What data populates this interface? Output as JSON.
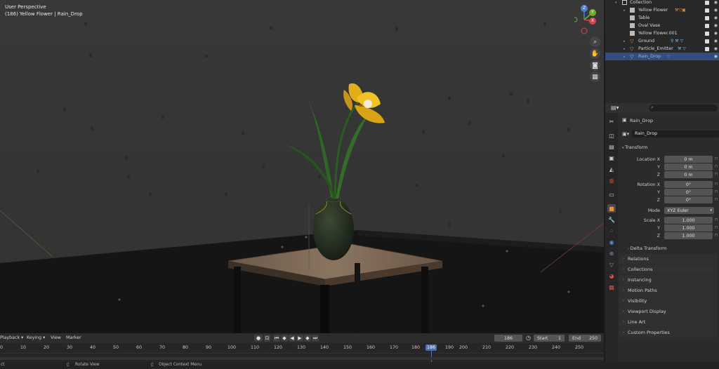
{
  "viewport": {
    "view_name": "User Perspective",
    "context": "(186) Yellow Flower | Rain_Drop",
    "gizmo": {
      "z": "Z",
      "y": "Y",
      "x": "X"
    }
  },
  "outliner": {
    "rows": [
      {
        "label": "Collection",
        "type": "collection"
      },
      {
        "label": "Yellow Flower",
        "type": "mesh"
      },
      {
        "label": "Table",
        "type": "mesh"
      },
      {
        "label": "Oval Vase",
        "type": "mesh"
      },
      {
        "label": "Yellow Flower.001",
        "type": "mesh"
      },
      {
        "label": "Ground",
        "type": "mesh"
      },
      {
        "label": "Particle_Emitter",
        "type": "mesh"
      },
      {
        "label": "Rain_Drop",
        "type": "mesh"
      }
    ]
  },
  "properties": {
    "object_name": "Rain_Drop",
    "data_name": "Rain_Drop",
    "transform_header": "Transform",
    "location": {
      "label": "Location X",
      "y": "Y",
      "z": "Z",
      "x_val": "0 m",
      "y_val": "0 m",
      "z_val": "0 m"
    },
    "rotation": {
      "label": "Rotation X",
      "y": "Y",
      "z": "Z",
      "x_val": "0°",
      "y_val": "0°",
      "z_val": "0°"
    },
    "mode_label": "Mode",
    "mode_value": "XYZ Euler",
    "scale": {
      "label": "Scale X",
      "y": "Y",
      "z": "Z",
      "x_val": "1.000",
      "y_val": "1.000",
      "z_val": "1.000"
    },
    "delta": "Delta Transform",
    "panels": [
      "Relations",
      "Collections",
      "Instancing",
      "Motion Paths",
      "Visibility",
      "Viewport Display",
      "Line Art",
      "Custom Properties"
    ]
  },
  "timeline": {
    "menus": [
      "Playback",
      "Keying",
      "View",
      "Marker"
    ],
    "current_frame": "186",
    "start_label": "Start",
    "start_value": "1",
    "end_label": "End",
    "end_value": "250",
    "ticks": [
      "0",
      "10",
      "20",
      "30",
      "40",
      "50",
      "60",
      "70",
      "80",
      "90",
      "100",
      "110",
      "120",
      "130",
      "140",
      "150",
      "160",
      "170",
      "180",
      "190",
      "200",
      "210",
      "220",
      "230",
      "240",
      "250"
    ]
  },
  "status": {
    "left": "ct",
    "rotate": "Rotate View",
    "context_menu": "Object Context Menu"
  },
  "colors": {
    "accent": "#4772b3",
    "flower": "#e8b81c",
    "modifier": "#e58f3a"
  }
}
